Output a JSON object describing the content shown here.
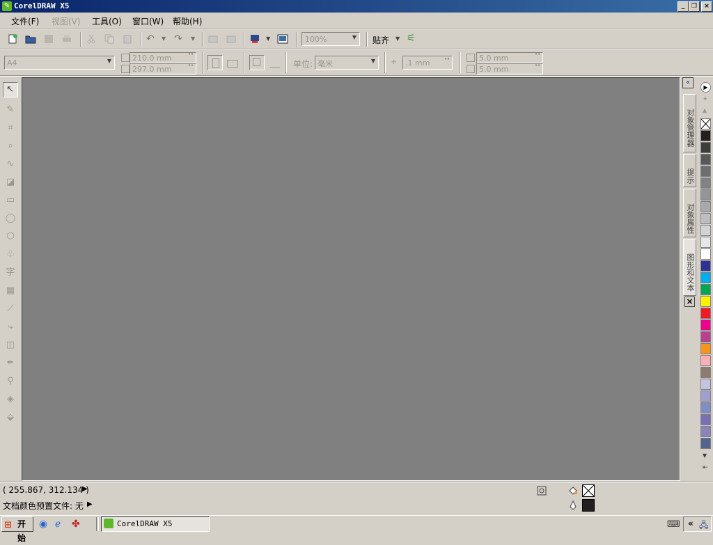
{
  "window": {
    "title": "CorelDRAW X5"
  },
  "menu": {
    "items": [
      {
        "label": "文件(F)",
        "enabled": true
      },
      {
        "label": "视图(V)",
        "enabled": false
      },
      {
        "label": "工具(O)",
        "enabled": true
      },
      {
        "label": "窗口(W)",
        "enabled": true
      },
      {
        "label": "帮助(H)",
        "enabled": true
      }
    ]
  },
  "standard_toolbar": {
    "zoom_value": "100%",
    "snap_label": "贴齐"
  },
  "property_bar": {
    "paper_size": "A4",
    "width": "210.0 mm",
    "height": "297.0 mm",
    "unit_label": "单位:",
    "unit_value": "毫米",
    "nudge": ".1 mm",
    "dup_x": "5.0 mm",
    "dup_y": "5.0 mm"
  },
  "dockers": {
    "tabs": [
      "对象管理器",
      "提示",
      "对象属性",
      "图形和文本"
    ]
  },
  "palette": {
    "colors": [
      "#231f20",
      "#3f3c3d",
      "#58585a",
      "#6d6e70",
      "#808285",
      "#939598",
      "#a7a9ac",
      "#bcbec0",
      "#d1d3d4",
      "#e6e7e8",
      "#ffffff",
      "#2e3192",
      "#00aeef",
      "#00a651",
      "#fff200",
      "#ed1c24",
      "#ec008c",
      "#b5418f",
      "#f7941d",
      "#f9b1b5",
      "#8c7b71",
      "#c5c4e0",
      "#a09fcf",
      "#7f8ec6",
      "#7a6fb5",
      "#8c84b8",
      "#53658f"
    ]
  },
  "status": {
    "coordinates": "( 255.867, 312.134 )",
    "color_profile": "文档颜色预置文件: 无"
  },
  "taskbar": {
    "start_label": "开始",
    "task_label": "CorelDRAW X5"
  }
}
